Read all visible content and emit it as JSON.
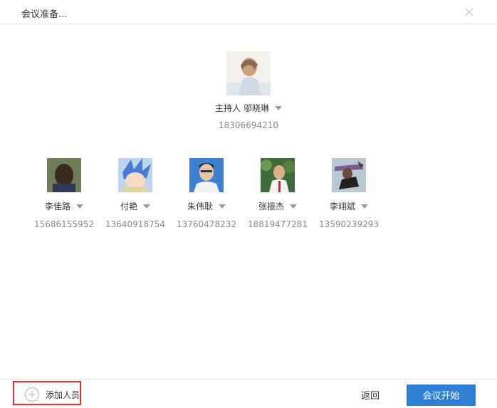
{
  "dialog": {
    "title": "会议准备..."
  },
  "host": {
    "role": "主持人",
    "name": "邬晓琳",
    "phone": "18306694210"
  },
  "members": [
    {
      "name": "李佳路",
      "phone": "15686155952"
    },
    {
      "name": "付艳",
      "phone": "13640918754"
    },
    {
      "name": "朱伟耿",
      "phone": "13760478232"
    },
    {
      "name": "张振杰",
      "phone": "18819477281"
    },
    {
      "name": "李翊斌",
      "phone": "13590239293"
    }
  ],
  "footer": {
    "add_label": "添加人员",
    "back_label": "返回",
    "start_label": "会议开始",
    "accent_color": "#2f7fd4",
    "highlight_color": "#e03030"
  }
}
